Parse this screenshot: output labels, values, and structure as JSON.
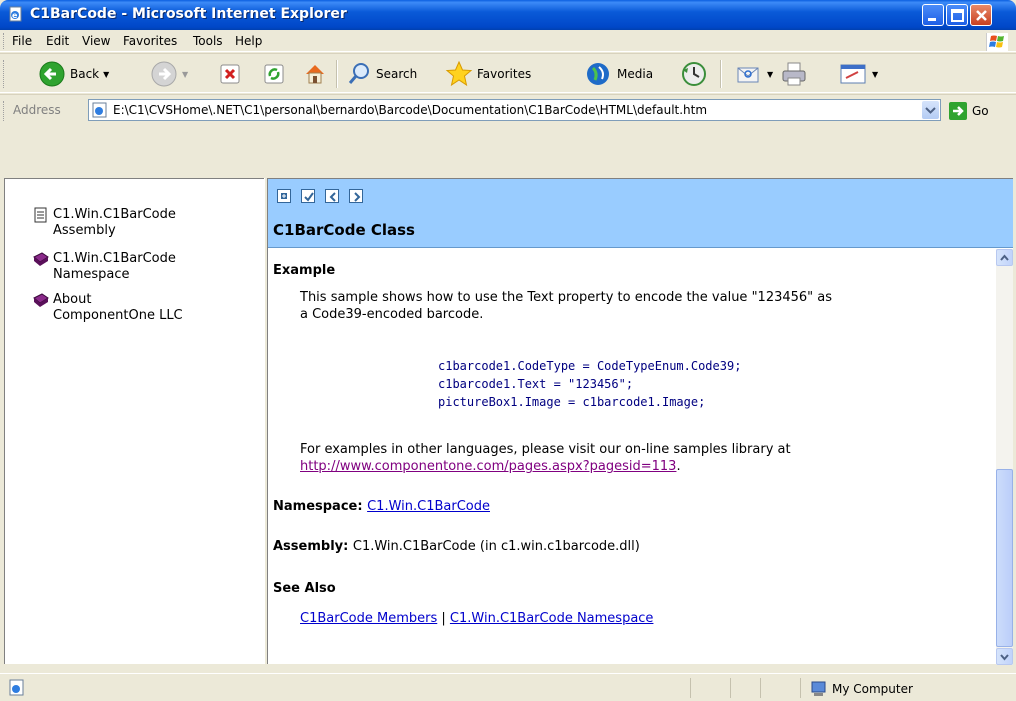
{
  "window": {
    "title": "C1BarCode - Microsoft Internet Explorer"
  },
  "menu": [
    "File",
    "Edit",
    "View",
    "Favorites",
    "Tools",
    "Help"
  ],
  "toolbar": {
    "back": "Back",
    "search": "Search",
    "favorites": "Favorites",
    "media": "Media"
  },
  "address": {
    "label": "Address",
    "url": "E:\\C1\\CVSHome\\.NET\\C1\\personal\\bernardo\\Barcode\\Documentation\\C1BarCode\\HTML\\default.htm",
    "go": "Go"
  },
  "toc": [
    {
      "label_line1": "C1.Win.C1BarCode",
      "label_line2": "Assembly",
      "icon": "page-icon"
    },
    {
      "label_line1": "C1.Win.C1BarCode",
      "label_line2": "Namespace",
      "icon": "book-icon"
    },
    {
      "label_line1": "About",
      "label_line2": "ComponentOne LLC",
      "icon": "book-icon"
    }
  ],
  "doc": {
    "title": "C1BarCode Class",
    "example_heading": "Example",
    "example_text_1": "This sample shows how to use the Text property to encode the value \"123456\" as",
    "example_text_2": "a Code39-encoded barcode.",
    "code_lines": [
      "c1barcode1.CodeType = CodeTypeEnum.Code39;",
      "c1barcode1.Text = \"123456\";",
      "pictureBox1.Image = c1barcode1.Image;"
    ],
    "more_text": "For examples in other languages, please visit our on-line samples library at",
    "samples_link": "http://www.componentone.com/pages.aspx?pagesid=113",
    "period": ".",
    "namespace_label": "Namespace:",
    "namespace_link": "C1.Win.C1BarCode",
    "assembly_label": "Assembly:",
    "assembly_value": "C1.Win.C1BarCode (in c1.win.c1barcode.dll)",
    "see_also": "See Also",
    "members_link": "C1BarCode Members",
    "separator": "|",
    "namespace_link2": "C1.Win.C1BarCode Namespace"
  },
  "status": {
    "zone": "My Computer"
  }
}
